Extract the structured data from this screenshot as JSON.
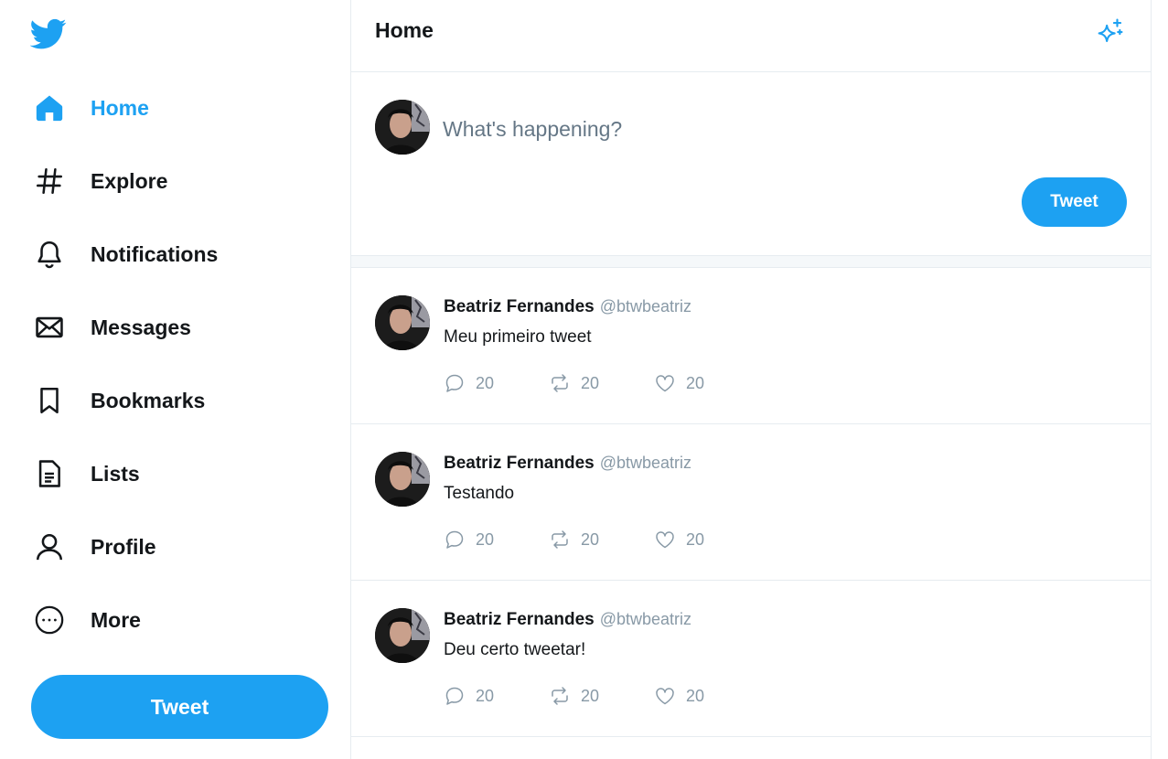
{
  "colors": {
    "brand": "#1da1f2",
    "text": "#14171a",
    "muted": "#8899a6"
  },
  "sidebar": {
    "logo_icon": "twitter-bird-icon",
    "items": [
      {
        "label": "Home",
        "icon": "home-icon",
        "active": true
      },
      {
        "label": "Explore",
        "icon": "hashtag-icon"
      },
      {
        "label": "Notifications",
        "icon": "bell-icon"
      },
      {
        "label": "Messages",
        "icon": "envelope-icon"
      },
      {
        "label": "Bookmarks",
        "icon": "bookmark-icon"
      },
      {
        "label": "Lists",
        "icon": "list-icon"
      },
      {
        "label": "Profile",
        "icon": "user-icon"
      },
      {
        "label": "More",
        "icon": "more-icon"
      }
    ],
    "tweet_button": "Tweet"
  },
  "header": {
    "title": "Home",
    "icon": "sparkle-icon"
  },
  "composer": {
    "placeholder": "What's happening?",
    "tweet_button": "Tweet"
  },
  "feed": [
    {
      "name": "Beatriz Fernandes",
      "handle": "@btwbeatriz",
      "text": "Meu primeiro tweet",
      "replies": "20",
      "retweets": "20",
      "likes": "20"
    },
    {
      "name": "Beatriz Fernandes",
      "handle": "@btwbeatriz",
      "text": "Testando",
      "replies": "20",
      "retweets": "20",
      "likes": "20"
    },
    {
      "name": "Beatriz Fernandes",
      "handle": "@btwbeatriz",
      "text": "Deu certo tweetar!",
      "replies": "20",
      "retweets": "20",
      "likes": "20"
    }
  ]
}
